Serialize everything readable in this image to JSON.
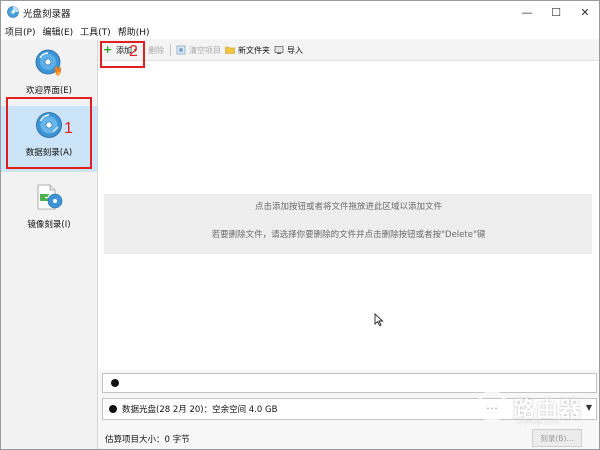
{
  "window": {
    "title": "光盘刻录器",
    "controls": {
      "minimize": "—",
      "maximize": "☐",
      "close": "✕"
    }
  },
  "menubar": [
    {
      "label": "项目(P)"
    },
    {
      "label": "编辑(E)"
    },
    {
      "label": "工具(T)"
    },
    {
      "label": "帮助(H)"
    }
  ],
  "sidebar": {
    "items": [
      {
        "label": "欢迎界面(E)",
        "icon": "disc-flame-icon",
        "selected": false
      },
      {
        "label": "数据刻录(A)",
        "icon": "data-disc-icon",
        "selected": true
      },
      {
        "label": "镜像刻录(I)",
        "icon": "image-burn-icon",
        "selected": false
      }
    ]
  },
  "toolbar": {
    "add": "添加",
    "delete": "删除",
    "clear": "清空项目",
    "new_folder": "新文件夹",
    "import": "导入"
  },
  "content": {
    "hint_line1": "点击添加按钮或者将文件拖放进此区域以添加文件",
    "hint_line2": "若要删除文件，请选择你要删除的文件并点击删除按钮或者按\"Delete\"键"
  },
  "drive": {
    "selected": "数据光盘(28 2月 20)：空余空间 4.0 GB"
  },
  "status": {
    "estimated_size": "估算项目大小：0 字节",
    "burn_button": "刻录(B)..."
  },
  "annotations": {
    "step1": "1",
    "step2": "2"
  },
  "watermark": {
    "text": "路由器",
    "sub": "luyouqi.com"
  },
  "colors": {
    "selection": "#cce4f7",
    "annotation": "#e02020"
  }
}
